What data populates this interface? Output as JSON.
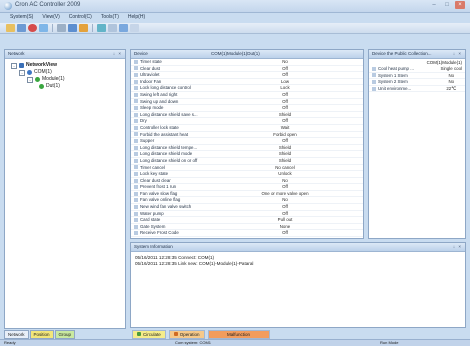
{
  "window": {
    "title": "Cron AC Controller 2009"
  },
  "menu": [
    "System(S)",
    "View(V)",
    "Control(C)",
    "Tools(T)",
    "Help(H)"
  ],
  "toolbar": {
    "icons": [
      "open-icon",
      "save-icon",
      "stop-icon",
      "refresh-icon",
      "settings-icon",
      "grid-icon",
      "help-icon",
      "info-icon",
      "tool-icon",
      "user-icon",
      "export-icon"
    ]
  },
  "network": {
    "title": "Network",
    "tree": [
      {
        "label": "NetworkView",
        "level": 0,
        "icon": "network-icon",
        "color": "#3a6fb6"
      },
      {
        "label": "COM(1)",
        "level": 1,
        "icon": "port-icon",
        "color": "#3f77c4"
      },
      {
        "label": "Module(1)",
        "level": 2,
        "icon": "module-icon",
        "color": "#3aa640"
      },
      {
        "label": "Dut(1)",
        "level": 3,
        "icon": "device-icon",
        "color": "#3aa640"
      }
    ],
    "tabs": [
      "Network",
      "Position",
      "Group"
    ]
  },
  "device": {
    "title": "Device",
    "subtitle": "COM(1)Module(1)Dut(1)",
    "rows": [
      [
        "Timer state",
        "No"
      ],
      [
        "Clear dust",
        "Off"
      ],
      [
        "Ultraviolet",
        "Off"
      ],
      [
        "Indoor Fan",
        "Low"
      ],
      [
        "Lock long distance control",
        "Lock"
      ],
      [
        "Swing left and right",
        "Off"
      ],
      [
        "Swing up and down",
        "Off"
      ],
      [
        "Sleep mode",
        "Off"
      ],
      [
        "Long distance shield save s...",
        "Shield"
      ],
      [
        "Dry",
        "Off"
      ],
      [
        "Controller lock state",
        "Wait"
      ],
      [
        "Forbid the assistant heat",
        "Forbid open"
      ],
      [
        "Supper",
        "Off"
      ],
      [
        "Long distance shield tempe...",
        "Shield"
      ],
      [
        "Long distance shield mode",
        "Shield"
      ],
      [
        "Long distance shield on or off",
        "Shield"
      ],
      [
        "Timer cancel",
        "No cancel"
      ],
      [
        "Lock key state",
        "Unlock"
      ],
      [
        "Clear dust clear",
        "No"
      ],
      [
        "Prevent frost 1 run",
        "Off"
      ],
      [
        "Fan valve slow flag",
        "One or more valve open"
      ],
      [
        "Fan valve online flag",
        "No"
      ],
      [
        "New wind fan valve switch",
        "Off"
      ],
      [
        "Water pump",
        "Off"
      ],
      [
        "Card state",
        "Pull out"
      ],
      [
        "Gate System",
        "None"
      ],
      [
        "Receive Frost Code",
        "Off"
      ]
    ]
  },
  "param": {
    "title": "Device the Public Collection...",
    "subtitle": "COM(1)Module(1)",
    "rows": [
      [
        "Cool heat pump ...",
        "Single cool"
      ],
      [
        "System 1 Stem",
        "No"
      ],
      [
        "System 2 Stem",
        "No"
      ],
      [
        "Unit environme...",
        "22℃"
      ]
    ]
  },
  "events": {
    "title": "System Information",
    "lines": [
      "05/16/2011 12:28:35 Connect: COM(1)",
      "05/16/2011 12:28:35 Link new: COM(1)-Module(1)-Pataral"
    ]
  },
  "bottom_tabs": [
    {
      "label": "Circulate",
      "color": "#4a9b3a"
    },
    {
      "label": "Operation",
      "color": "#d06a22"
    },
    {
      "label": "Malfunction",
      "color": ""
    }
  ],
  "status": {
    "left": "Ready",
    "mid": "Com system: COM1",
    "right": "Run Mode"
  }
}
